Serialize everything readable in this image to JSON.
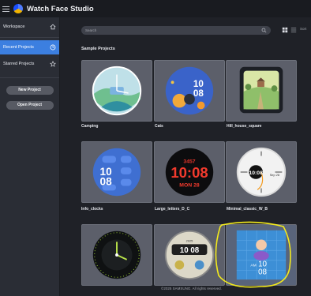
{
  "app": {
    "title": "Watch Face Studio"
  },
  "sidebar": {
    "items": [
      {
        "label": "Workspace",
        "icon": "home-icon"
      },
      {
        "label": "Recent Projects",
        "icon": "clock-icon"
      },
      {
        "label": "Starred Projects",
        "icon": "star-icon"
      }
    ],
    "new_project_label": "New Project",
    "open_project_label": "Open Project"
  },
  "toolbar": {
    "search_placeholder": "Search",
    "sort_label": "Sort"
  },
  "main": {
    "section_title": "Sample Projects",
    "projects": [
      {
        "name": "Camping"
      },
      {
        "name": "Cats",
        "time_top": "10",
        "time_bottom": "08"
      },
      {
        "name": "Hill_house_square"
      },
      {
        "name": "Info_clocks",
        "time_top": "10",
        "time_bottom": "08"
      },
      {
        "name": "Large_letters_D_C",
        "top_number": "3457",
        "time": "10:08",
        "date": "MON 28"
      },
      {
        "name": "Minimal_classic_W_B",
        "time": "10:08",
        "date": "Sep 28"
      },
      {
        "name": ""
      },
      {
        "name": "",
        "time": "10 08",
        "year": "2025"
      },
      {
        "name": "",
        "ampm": "AM",
        "time_top": "10",
        "time_bottom": "08"
      }
    ]
  },
  "footer": {
    "copyright": "©2025 SAMSUNG. All rights reserved."
  },
  "colors": {
    "accent": "#3c7fe0",
    "highlight": "#f3ea1c",
    "background": "#1f2127"
  }
}
